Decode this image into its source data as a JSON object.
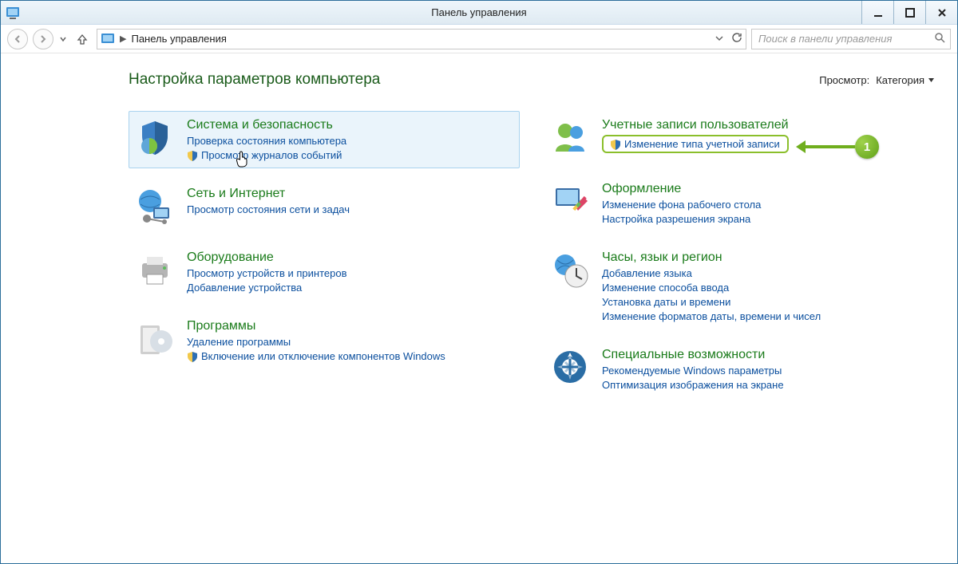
{
  "window": {
    "title": "Панель управления"
  },
  "addressbar": {
    "location": "Панель управления"
  },
  "search": {
    "placeholder": "Поиск в панели управления"
  },
  "view": {
    "label": "Просмотр:",
    "value": "Категория"
  },
  "heading": "Настройка параметров компьютера",
  "left": [
    {
      "title": "Система и безопасность",
      "links": [
        {
          "label": "Проверка состояния компьютера",
          "shield": false
        },
        {
          "label": "Просмотр журналов событий",
          "shield": true
        }
      ]
    },
    {
      "title": "Сеть и Интернет",
      "links": [
        {
          "label": "Просмотр состояния сети и задач",
          "shield": false
        }
      ]
    },
    {
      "title": "Оборудование",
      "links": [
        {
          "label": "Просмотр устройств и принтеров",
          "shield": false
        },
        {
          "label": "Добавление устройства",
          "shield": false
        }
      ]
    },
    {
      "title": "Программы",
      "links": [
        {
          "label": "Удаление программы",
          "shield": false
        },
        {
          "label": "Включение или отключение компонентов Windows",
          "shield": true
        }
      ]
    }
  ],
  "right": [
    {
      "title": "Учетные записи пользователей",
      "links": [
        {
          "label": "Изменение типа учетной записи",
          "shield": true,
          "highlighted": true
        }
      ]
    },
    {
      "title": "Оформление",
      "links": [
        {
          "label": "Изменение фона рабочего стола",
          "shield": false
        },
        {
          "label": "Настройка разрешения экрана",
          "shield": false
        }
      ]
    },
    {
      "title": "Часы, язык и регион",
      "links": [
        {
          "label": "Добавление языка",
          "shield": false
        },
        {
          "label": "Изменение способа ввода",
          "shield": false
        },
        {
          "label": "Установка даты и времени",
          "shield": false
        },
        {
          "label": "Изменение форматов даты, времени и чисел",
          "shield": false
        }
      ]
    },
    {
      "title": "Специальные возможности",
      "links": [
        {
          "label": "Рекомендуемые Windows параметры",
          "shield": false
        },
        {
          "label": "Оптимизация изображения на экране",
          "shield": false
        }
      ]
    }
  ],
  "callout": {
    "number": "1"
  }
}
